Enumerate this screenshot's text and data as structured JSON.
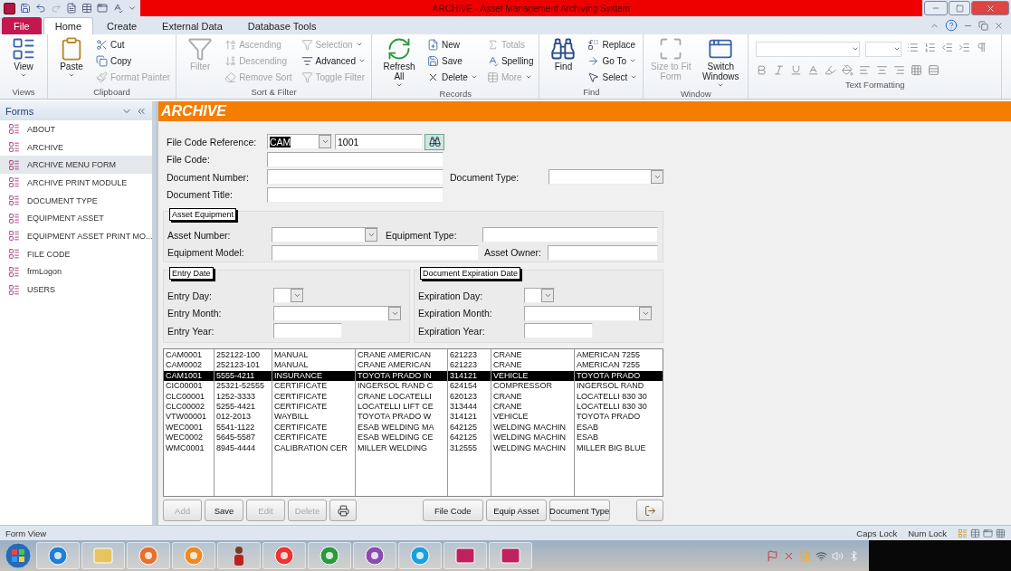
{
  "title_bar": {
    "title": "ARCHIVE  -  Asset Management Archiving System"
  },
  "ribbon": {
    "tabs": [
      {
        "label": "File",
        "kind": "file",
        "selected": false
      },
      {
        "label": "Home",
        "kind": "tab",
        "selected": true
      },
      {
        "label": "Create",
        "kind": "tab",
        "selected": false
      },
      {
        "label": "External Data",
        "kind": "tab",
        "selected": false
      },
      {
        "label": "Database Tools",
        "kind": "tab",
        "selected": false
      }
    ],
    "groups": [
      {
        "label": "Views",
        "kind": "buttons",
        "items": [
          {
            "label": "View",
            "kind": "large",
            "dropdown": true,
            "disabled": false
          }
        ]
      },
      {
        "label": "Clipboard",
        "kind": "buttons",
        "items": [
          {
            "label": "Paste",
            "kind": "large",
            "dropdown": true,
            "disabled": false
          },
          {
            "label": "Cut",
            "kind": "small",
            "dropdown": false,
            "disabled": false
          },
          {
            "label": "Copy",
            "kind": "small",
            "dropdown": false,
            "disabled": false
          },
          {
            "label": "Format Painter",
            "kind": "small",
            "dropdown": false,
            "disabled": true
          }
        ]
      },
      {
        "label": "Sort & Filter",
        "kind": "buttons",
        "items": [
          {
            "label": "Filter",
            "kind": "large",
            "dropdown": false,
            "disabled": true
          },
          {
            "label": "Ascending",
            "kind": "small",
            "dropdown": false,
            "disabled": true
          },
          {
            "label": "Descending",
            "kind": "small",
            "dropdown": false,
            "disabled": true
          },
          {
            "label": "Remove Sort",
            "kind": "small",
            "dropdown": false,
            "disabled": true
          },
          {
            "label": "Selection",
            "kind": "small",
            "dropdown": true,
            "disabled": true
          },
          {
            "label": "Advanced",
            "kind": "small",
            "dropdown": true,
            "disabled": false
          },
          {
            "label": "Toggle Filter",
            "kind": "small",
            "dropdown": false,
            "disabled": true
          }
        ]
      },
      {
        "label": "Records",
        "kind": "buttons",
        "items": [
          {
            "label": "Refresh All",
            "kind": "large",
            "dropdown": true,
            "disabled": false
          },
          {
            "label": "New",
            "kind": "small",
            "dropdown": false,
            "disabled": false
          },
          {
            "label": "Save",
            "kind": "small",
            "dropdown": false,
            "disabled": false
          },
          {
            "label": "Delete",
            "kind": "small",
            "dropdown": true,
            "disabled": false
          },
          {
            "label": "Totals",
            "kind": "small",
            "dropdown": false,
            "disabled": true
          },
          {
            "label": "Spelling",
            "kind": "small",
            "dropdown": false,
            "disabled": false
          },
          {
            "label": "More",
            "kind": "small",
            "dropdown": true,
            "disabled": true
          }
        ]
      },
      {
        "label": "Find",
        "kind": "buttons",
        "items": [
          {
            "label": "Find",
            "kind": "large",
            "dropdown": false,
            "disabled": false
          },
          {
            "label": "Replace",
            "kind": "small",
            "dropdown": false,
            "disabled": false
          },
          {
            "label": "Go To",
            "kind": "small",
            "dropdown": true,
            "disabled": false
          },
          {
            "label": "Select",
            "kind": "small",
            "dropdown": true,
            "disabled": false
          }
        ]
      },
      {
        "label": "Window",
        "kind": "buttons",
        "items": [
          {
            "label": "Size to Fit Form",
            "kind": "large",
            "dropdown": false,
            "disabled": true
          },
          {
            "label": "Switch Windows",
            "kind": "large",
            "dropdown": true,
            "disabled": false
          }
        ]
      },
      {
        "label": "Text Formatting",
        "kind": "formatting"
      }
    ]
  },
  "navigation": {
    "title": "Forms",
    "items": [
      {
        "label": "ABOUT",
        "selected": false
      },
      {
        "label": "ARCHIVE",
        "selected": false
      },
      {
        "label": "ARCHIVE MENU FORM",
        "selected": true
      },
      {
        "label": "ARCHIVE PRINT MODULE",
        "selected": false
      },
      {
        "label": "DOCUMENT TYPE",
        "selected": false
      },
      {
        "label": "EQUIPMENT ASSET",
        "selected": false
      },
      {
        "label": "EQUIPMENT ASSET PRINT MO...",
        "selected": false
      },
      {
        "label": "FILE CODE",
        "selected": false
      },
      {
        "label": "frmLogon",
        "selected": false
      },
      {
        "label": "USERS",
        "selected": false
      }
    ]
  },
  "form": {
    "title": "ARCHIVE",
    "file_code_reference": {
      "label": "File Code Reference:",
      "code": "CAM",
      "code_highlighted": true,
      "number": "1001"
    },
    "file_code": {
      "label": "File Code:"
    },
    "document_number": {
      "label": "Document Number:"
    },
    "document_type": {
      "label": "Document Type:"
    },
    "document_title": {
      "label": "Document Title:"
    },
    "asset_equipment": {
      "legend": "Asset Equipment",
      "asset_number": "Asset Number:",
      "equipment_type": "Equipment Type:",
      "equipment_model": "Equipment Model:",
      "asset_owner": "Asset Owner:"
    },
    "entry_date": {
      "legend": "Entry Date",
      "day": "Entry Day:",
      "month": "Entry Month:",
      "year": "Entry Year:"
    },
    "expiration_date": {
      "legend": "Document Expiration Date",
      "day": "Expiration Day:",
      "month": "Expiration Month:",
      "year": "Expiration Year:"
    },
    "records": {
      "rows": [
        {
          "cells": [
            "CAM0001",
            "252122-100",
            "MANUAL",
            "CRANE AMERICAN",
            "621223",
            "CRANE",
            "AMERICAN 7255"
          ],
          "selected": false
        },
        {
          "cells": [
            "CAM0002",
            "252123-101",
            "MANUAL",
            "CRANE AMERICAN",
            "621223",
            "CRANE",
            "AMERICAN 7255"
          ],
          "selected": false
        },
        {
          "cells": [
            "CAM1001",
            "5555-4211",
            "INSURANCE",
            "TOYOTA PRADO IN",
            "314121",
            "VEHICLE",
            "TOYOTA PRADO"
          ],
          "selected": true
        },
        {
          "cells": [
            "CIC00001",
            "25321-52555",
            "CERTIFICATE",
            "INGERSOL RAND C",
            "624154",
            "COMPRESSOR",
            "INGERSOL RAND"
          ],
          "selected": false
        },
        {
          "cells": [
            "CLC00001",
            "1252-3333",
            "CERTIFICATE",
            "CRANE LOCATELLI",
            "620123",
            "CRANE",
            "LOCATELLI 830 30"
          ],
          "selected": false
        },
        {
          "cells": [
            "CLC00002",
            "5255-4421",
            "CERTIFICATE",
            "LOCATELLI LIFT CE",
            "313444",
            "CRANE",
            "LOCATELLI 830 30"
          ],
          "selected": false
        },
        {
          "cells": [
            "VTW00001",
            "012-2013",
            "WAYBILL",
            "TOYOTA PRADO W",
            "314121",
            "VEHICLE",
            "TOYOTA PRADO"
          ],
          "selected": false
        },
        {
          "cells": [
            "WEC0001",
            "5541-1122",
            "CERTIFICATE",
            "ESAB WELDING MA",
            "642125",
            "WELDING MACHIN",
            "ESAB"
          ],
          "selected": false
        },
        {
          "cells": [
            "WEC0002",
            "5645-5587",
            "CERTIFICATE",
            "ESAB WELDING CE",
            "642125",
            "WELDING MACHIN",
            "ESAB"
          ],
          "selected": false
        },
        {
          "cells": [
            "WMC0001",
            "8945-4444",
            "CALIBRATION CER",
            "MILLER WELDING",
            "312555",
            "WELDING MACHIN",
            "MILLER BIG BLUE"
          ],
          "selected": false
        }
      ]
    },
    "buttons": [
      {
        "kind": "record",
        "label": "Add",
        "disabled": true
      },
      {
        "kind": "record",
        "label": "Save",
        "disabled": false
      },
      {
        "kind": "record",
        "label": "Edit",
        "disabled": true
      },
      {
        "kind": "record",
        "label": "Delete",
        "disabled": true
      },
      {
        "kind": "print",
        "disabled": false
      },
      {
        "kind": "nav",
        "label": "File Code",
        "disabled": false
      },
      {
        "kind": "nav",
        "label": "Equip Asset",
        "disabled": false
      },
      {
        "kind": "nav",
        "label": "Document Type",
        "disabled": false
      },
      {
        "kind": "exit",
        "disabled": false
      }
    ]
  },
  "status_bar": {
    "view": "Form View",
    "indicators": [
      "Caps Lock",
      "Num Lock"
    ]
  }
}
